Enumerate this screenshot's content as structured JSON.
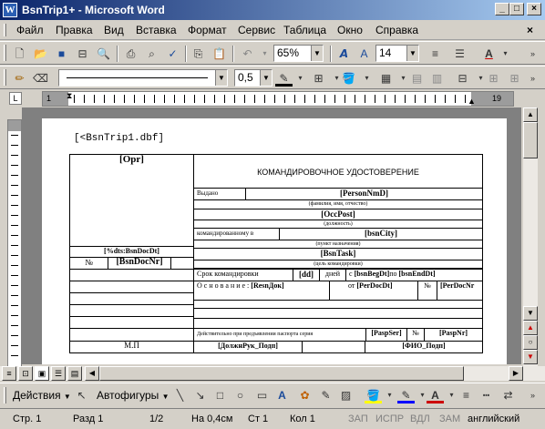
{
  "window": {
    "title": "BsnTrip1+ - Microsoft Word"
  },
  "menu": [
    "Файл",
    "Правка",
    "Вид",
    "Вставка",
    "Формат",
    "Сервис",
    "Таблица",
    "Окно",
    "Справка"
  ],
  "toolbar": {
    "zoom": "65%",
    "font_size": "14",
    "line_width": "0,5"
  },
  "drawing": {
    "actions": "Действия",
    "autoshapes": "Автофигуры"
  },
  "ruler": {
    "left": "1",
    "right": "19"
  },
  "document": {
    "header_field": "[<BsnTrip1.dbf]",
    "org": "[Opr]",
    "title": "КОМАНДИРОВОЧНОЕ УДОСТОВЕРЕНИЕ",
    "issued_label": "Выдано",
    "person": "[PersonNmD]",
    "person_hint": "(фамилия, имя, отчество)",
    "post": "[OccPost]",
    "post_hint": "(должность)",
    "sent_label": "командированному в",
    "city": "[bsnCity]",
    "city_hint": "(пункт назначения)",
    "doc_date": "[%dts:BsnDocDt]",
    "num_label": "№",
    "doc_nr": "[BsnDocNr]",
    "task": "[BsnTask]",
    "task_hint": "(цель командировки)",
    "term_label": "Срок командировки",
    "days": "[dd]",
    "days_label": "дней",
    "from_label": "с",
    "beg_dt": "[bsnBegDt]",
    "to_label": "по",
    "end_dt": "[bsnEndDt]",
    "basis_label": "О с н о в а н и е :",
    "basis": "[ResnДок]",
    "from2_label": "от",
    "per_doc_dt": "[PerDocDt]",
    "num2_label": "№",
    "per_doc_nr": "[PerDocNr",
    "passport_label": "Действительно при предъявлении паспорта серия",
    "pasp_ser": "[PaspSer]",
    "num3_label": "№",
    "pasp_nr": "[PaspNr]",
    "mp": "М.П",
    "head_post": "[ДолжнРук_Подп]",
    "head_name": "[ФИО_Подп]"
  },
  "status": {
    "page": "Стр. 1",
    "section": "Разд 1",
    "pages": "1/2",
    "at": "На 0,4см",
    "line": "Ст 1",
    "col": "Кол 1",
    "rec": "ЗАП",
    "trk": "ИСПР",
    "ext": "ВДЛ",
    "ovr": "ЗАМ",
    "lang": "английский"
  }
}
